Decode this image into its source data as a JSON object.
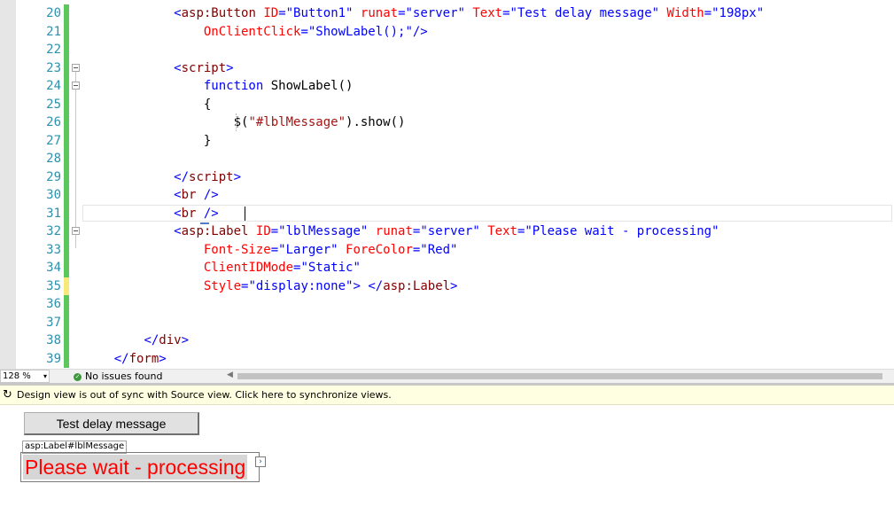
{
  "editor": {
    "lines": [
      {
        "num": "20",
        "chg": "green",
        "fold": false,
        "tokens": [
          {
            "t": "            ",
            "c": "plain"
          },
          {
            "t": "<",
            "c": "delim"
          },
          {
            "t": "asp:Button",
            "c": "tag"
          },
          {
            "t": " ",
            "c": "plain"
          },
          {
            "t": "ID",
            "c": "attr"
          },
          {
            "t": "=\"Button1\"",
            "c": "val"
          },
          {
            "t": " ",
            "c": "plain"
          },
          {
            "t": "runat",
            "c": "attr"
          },
          {
            "t": "=\"server\"",
            "c": "val"
          },
          {
            "t": " ",
            "c": "plain"
          },
          {
            "t": "Text",
            "c": "attr"
          },
          {
            "t": "=\"Test delay message\"",
            "c": "val"
          },
          {
            "t": " ",
            "c": "plain"
          },
          {
            "t": "Width",
            "c": "attr"
          },
          {
            "t": "=\"198px\"",
            "c": "val"
          }
        ]
      },
      {
        "num": "21",
        "chg": "green",
        "fold": false,
        "tokens": [
          {
            "t": "                ",
            "c": "plain"
          },
          {
            "t": "OnClientClick",
            "c": "attr"
          },
          {
            "t": "=\"ShowLabel();\"",
            "c": "val"
          },
          {
            "t": "/>",
            "c": "delim"
          }
        ]
      },
      {
        "num": "22",
        "chg": "green",
        "fold": false,
        "tokens": []
      },
      {
        "num": "23",
        "chg": "green",
        "fold": true,
        "tokens": [
          {
            "t": "            ",
            "c": "plain"
          },
          {
            "t": "<",
            "c": "delim"
          },
          {
            "t": "script",
            "c": "tag"
          },
          {
            "t": ">",
            "c": "delim"
          }
        ]
      },
      {
        "num": "24",
        "chg": "green",
        "fold": true,
        "tokens": [
          {
            "t": "                ",
            "c": "plain"
          },
          {
            "t": "function",
            "c": "kw"
          },
          {
            "t": " ShowLabel()",
            "c": "plain"
          }
        ]
      },
      {
        "num": "25",
        "chg": "green",
        "fold": false,
        "tokens": [
          {
            "t": "                {",
            "c": "plain"
          }
        ]
      },
      {
        "num": "26",
        "chg": "green",
        "fold": false,
        "tokens": [
          {
            "t": "                    $(",
            "c": "plain"
          },
          {
            "t": "\"#lblMessage\"",
            "c": "str"
          },
          {
            "t": ").show()",
            "c": "plain"
          }
        ]
      },
      {
        "num": "27",
        "chg": "green",
        "fold": false,
        "tokens": [
          {
            "t": "                }",
            "c": "plain"
          }
        ]
      },
      {
        "num": "28",
        "chg": "green",
        "fold": false,
        "tokens": []
      },
      {
        "num": "29",
        "chg": "green",
        "fold": false,
        "tokens": [
          {
            "t": "            ",
            "c": "plain"
          },
          {
            "t": "</",
            "c": "delim"
          },
          {
            "t": "script",
            "c": "tag"
          },
          {
            "t": ">",
            "c": "delim"
          }
        ]
      },
      {
        "num": "30",
        "chg": "green",
        "fold": false,
        "tokens": [
          {
            "t": "            ",
            "c": "plain"
          },
          {
            "t": "<",
            "c": "delim"
          },
          {
            "t": "br",
            "c": "tag"
          },
          {
            "t": " />",
            "c": "delim"
          }
        ]
      },
      {
        "num": "31",
        "chg": "green",
        "fold": false,
        "tokens": [
          {
            "t": "            ",
            "c": "plain"
          },
          {
            "t": "<",
            "c": "delim"
          },
          {
            "t": "br",
            "c": "tag"
          },
          {
            "t": " />",
            "c": "delim"
          }
        ]
      },
      {
        "num": "32",
        "chg": "green",
        "fold": true,
        "tokens": [
          {
            "t": "            ",
            "c": "plain"
          },
          {
            "t": "<",
            "c": "delim"
          },
          {
            "t": "asp:Label",
            "c": "tag"
          },
          {
            "t": " ",
            "c": "plain"
          },
          {
            "t": "ID",
            "c": "attr"
          },
          {
            "t": "=\"lblMessage\"",
            "c": "val"
          },
          {
            "t": " ",
            "c": "plain"
          },
          {
            "t": "runat",
            "c": "attr"
          },
          {
            "t": "=\"server\"",
            "c": "val"
          },
          {
            "t": " ",
            "c": "plain"
          },
          {
            "t": "Text",
            "c": "attr"
          },
          {
            "t": "=\"Please wait - processing\"",
            "c": "val"
          }
        ]
      },
      {
        "num": "33",
        "chg": "green",
        "fold": false,
        "tokens": [
          {
            "t": "                ",
            "c": "plain"
          },
          {
            "t": "Font-Size",
            "c": "attr"
          },
          {
            "t": "=\"Larger\"",
            "c": "val"
          },
          {
            "t": " ",
            "c": "plain"
          },
          {
            "t": "ForeColor",
            "c": "attr"
          },
          {
            "t": "=\"Red\"",
            "c": "val"
          }
        ]
      },
      {
        "num": "34",
        "chg": "green",
        "fold": false,
        "tokens": [
          {
            "t": "                ",
            "c": "plain"
          },
          {
            "t": "ClientIDMode",
            "c": "attr"
          },
          {
            "t": "=\"Static\"",
            "c": "val"
          }
        ]
      },
      {
        "num": "35",
        "chg": "yellow",
        "fold": false,
        "tokens": [
          {
            "t": "                ",
            "c": "plain"
          },
          {
            "t": "Style",
            "c": "attr"
          },
          {
            "t": "=\"display:none\"",
            "c": "val"
          },
          {
            "t": ">",
            "c": "delim"
          },
          {
            "t": " ",
            "c": "plain"
          },
          {
            "t": "</",
            "c": "delim"
          },
          {
            "t": "asp:Label",
            "c": "tag"
          },
          {
            "t": ">",
            "c": "delim"
          }
        ]
      },
      {
        "num": "36",
        "chg": "green",
        "fold": false,
        "tokens": []
      },
      {
        "num": "37",
        "chg": "green",
        "fold": false,
        "tokens": []
      },
      {
        "num": "38",
        "chg": "green",
        "fold": false,
        "tokens": [
          {
            "t": "        ",
            "c": "plain"
          },
          {
            "t": "</",
            "c": "delim"
          },
          {
            "t": "div",
            "c": "tag"
          },
          {
            "t": ">",
            "c": "delim"
          }
        ]
      },
      {
        "num": "39",
        "chg": "green",
        "fold": false,
        "tokens": [
          {
            "t": "    ",
            "c": "plain"
          },
          {
            "t": "</",
            "c": "delim"
          },
          {
            "t": "form",
            "c": "tag"
          },
          {
            "t": ">",
            "c": "delim"
          }
        ]
      }
    ],
    "colors": {
      "green": "#5cc75c",
      "yellow": "#f7e97a"
    }
  },
  "status": {
    "zoom": "128 %",
    "zoom_arrow": "▾",
    "issues_icon": "✓",
    "issues": "No issues found",
    "scroll_left_arrow": "◀"
  },
  "sync": {
    "icon": "↻",
    "message": "Design view is out of sync with Source view. Click here to synchronize views."
  },
  "design": {
    "button_text": "Test delay message",
    "label_tag": "asp:Label#lblMessage",
    "label_text": "Please wait - processing",
    "chevron": "›"
  }
}
